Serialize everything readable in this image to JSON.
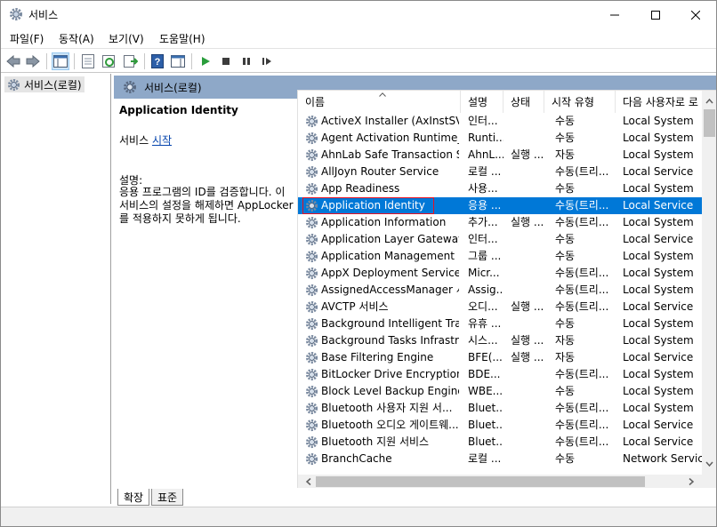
{
  "window": {
    "title": "서비스",
    "title_icon": "gear-icon"
  },
  "menu": [
    {
      "label": "파일(F)"
    },
    {
      "label": "동작(A)"
    },
    {
      "label": "보기(V)"
    },
    {
      "label": "도움말(H)"
    }
  ],
  "toolbar": {
    "icons": [
      "back-arrow-icon",
      "forward-arrow-icon",
      "console-tree-icon",
      "properties-icon",
      "refresh-icon",
      "export-list-icon",
      "help-icon",
      "action-pane-icon",
      "start-service-icon",
      "stop-service-icon",
      "pause-service-icon",
      "restart-service-icon"
    ]
  },
  "tree": {
    "item_label": "서비스(로컬)"
  },
  "banner": {
    "title": "서비스(로컬)"
  },
  "description_pane": {
    "service_name": "Application Identity",
    "action_prefix": "서비스 ",
    "action_link": "시작",
    "label": "설명:",
    "text": "응용 프로그램의 ID를 검증합니다. 이 서비스의 설정을 해제하면 AppLocker를 적용하지 못하게 됩니다."
  },
  "columns": {
    "name": "이름",
    "description": "설명",
    "status": "상태",
    "startup": "시작 유형",
    "logon": "다음 사용자로 로"
  },
  "services": [
    {
      "name": "ActiveX Installer (AxInstSV)",
      "description": "인터...",
      "status": "",
      "startup": "수동",
      "logon": "Local System"
    },
    {
      "name": "Agent Activation Runtime_...",
      "description": "Runti...",
      "status": "",
      "startup": "수동",
      "logon": "Local System"
    },
    {
      "name": "AhnLab Safe Transaction S...",
      "description": "AhnL...",
      "status": "실행 ...",
      "startup": "자동",
      "logon": "Local System"
    },
    {
      "name": "AllJoyn Router Service",
      "description": "로컬 ...",
      "status": "",
      "startup": "수동(트리...",
      "logon": "Local Service"
    },
    {
      "name": "App Readiness",
      "description": "사용...",
      "status": "",
      "startup": "수동",
      "logon": "Local System"
    },
    {
      "name": "Application Identity",
      "description": "응용 ...",
      "status": "",
      "startup": "수동(트리...",
      "logon": "Local Service"
    },
    {
      "name": "Application Information",
      "description": "추가...",
      "status": "실행 ...",
      "startup": "수동(트리...",
      "logon": "Local System"
    },
    {
      "name": "Application Layer Gateway ...",
      "description": "인터...",
      "status": "",
      "startup": "수동",
      "logon": "Local Service"
    },
    {
      "name": "Application Management",
      "description": "그룹 ...",
      "status": "",
      "startup": "수동",
      "logon": "Local System"
    },
    {
      "name": "AppX Deployment Service ...",
      "description": "Micr...",
      "status": "",
      "startup": "수동(트리...",
      "logon": "Local System"
    },
    {
      "name": "AssignedAccessManager 서...",
      "description": "Assig...",
      "status": "",
      "startup": "수동(트리...",
      "logon": "Local System"
    },
    {
      "name": "AVCTP 서비스",
      "description": "오디...",
      "status": "실행 ...",
      "startup": "수동(트리...",
      "logon": "Local Service"
    },
    {
      "name": "Background Intelligent Tra...",
      "description": "유휴 ...",
      "status": "",
      "startup": "수동",
      "logon": "Local System"
    },
    {
      "name": "Background Tasks Infrastru...",
      "description": "시스...",
      "status": "실행 ...",
      "startup": "자동",
      "logon": "Local System"
    },
    {
      "name": "Base Filtering Engine",
      "description": "BFE(...",
      "status": "실행 ...",
      "startup": "자동",
      "logon": "Local Service"
    },
    {
      "name": "BitLocker Drive Encryption ...",
      "description": "BDE...",
      "status": "",
      "startup": "수동(트리...",
      "logon": "Local System"
    },
    {
      "name": "Block Level Backup Engine ...",
      "description": "WBE...",
      "status": "",
      "startup": "수동",
      "logon": "Local System"
    },
    {
      "name": "Bluetooth 사용자 지원 서...",
      "description": "Bluet...",
      "status": "",
      "startup": "수동(트리...",
      "logon": "Local System"
    },
    {
      "name": "Bluetooth 오디오 게이트웨...",
      "description": "Bluet...",
      "status": "",
      "startup": "수동(트리...",
      "logon": "Local Service"
    },
    {
      "name": "Bluetooth 지원 서비스",
      "description": "Bluet...",
      "status": "",
      "startup": "수동(트리...",
      "logon": "Local Service"
    },
    {
      "name": "BranchCache",
      "description": "로컬 ...",
      "status": "",
      "startup": "수동",
      "logon": "Network Service"
    }
  ],
  "selected_index": 5,
  "tabs": [
    {
      "label": "확장"
    },
    {
      "label": "표준"
    }
  ],
  "colors": {
    "selection": "#0078d7",
    "banner": "#8ea8c8",
    "highlight_box": "#e81123",
    "link": "#0645ad"
  }
}
